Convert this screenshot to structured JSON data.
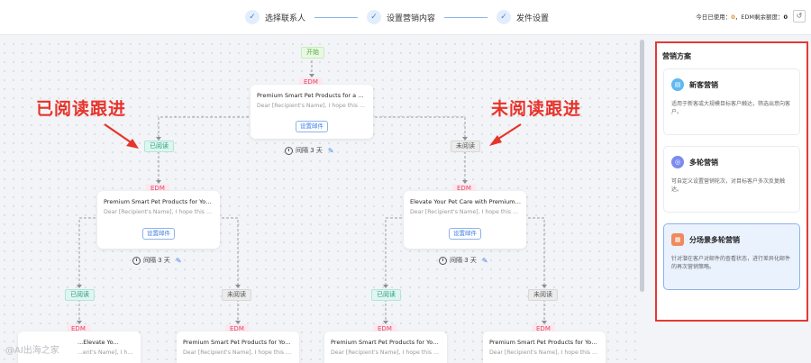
{
  "header": {
    "steps": [
      {
        "label": "选择联系人",
        "icon": "check-icon"
      },
      {
        "label": "设置营销内容",
        "icon": "check-icon"
      },
      {
        "label": "发件设置",
        "icon": "check-icon"
      }
    ],
    "usage_label": "今日已使用：",
    "usage_value": "0",
    "quota_label": "，EDM剩余额度：",
    "quota_value": "0",
    "undo_icon": "undo-icon"
  },
  "flow": {
    "start_label": "开始",
    "edm_tag": "EDM",
    "read_tag": "已阅读",
    "unread_tag": "未阅读",
    "setup_button": "设置邮件",
    "root_card": {
      "title": "Premium Smart Pet Products for a Health...",
      "preview": "Dear [Recipient's Name], I hope this emai..."
    },
    "root_interval": "间隔 3 天",
    "left_card": {
      "title": "Premium Smart Pet Products for Your Bus...",
      "preview": "Dear [Recipient's Name], I hope this emai..."
    },
    "left_interval": "间隔 3 天",
    "right_card": {
      "title": "Elevate Your Pet Care with Premium Smar...",
      "preview": "Dear [Recipient's Name], I hope this emai..."
    },
    "right_interval": "间隔 3 天",
    "bottom_cards": [
      {
        "title": "...Elevate Yo...",
        "preview": "...ent's Name], I hope..."
      },
      {
        "title": "Premium Smart Pet Products for Your Cu...",
        "preview": "Dear [Recipient's Name], I hope this emai..."
      },
      {
        "title": "Premium Smart Pet Products for Your Store",
        "preview": "Dear [Recipient's Name], I hope this emai..."
      },
      {
        "title": "Premium Smart Pet Products for Your Bus...",
        "preview": "Dear [Recipient's Name], I hope this emai..."
      }
    ]
  },
  "annotations": {
    "read_followup": "已阅读跟进",
    "unread_followup": "未阅读跟进"
  },
  "panel": {
    "title": "营销方案",
    "plans": [
      {
        "name": "新客营销",
        "desc": "适用于新客或大规模目标客户触达，筛选出意向客户。",
        "icon": "store-icon",
        "color": "#5fb8f0"
      },
      {
        "name": "多轮营销",
        "desc": "可自定义设置营销轮次，对目标客户多次反复触达。",
        "icon": "cycle-icon",
        "color": "#7b8cf0"
      },
      {
        "name": "分场景多轮营销",
        "desc": "针对潜在客户对邮件的查看状态，进行差异化邮件的再次营销策略。",
        "icon": "scene-icon",
        "color": "#f08a5d"
      }
    ]
  },
  "watermark": "@AI出海之家"
}
